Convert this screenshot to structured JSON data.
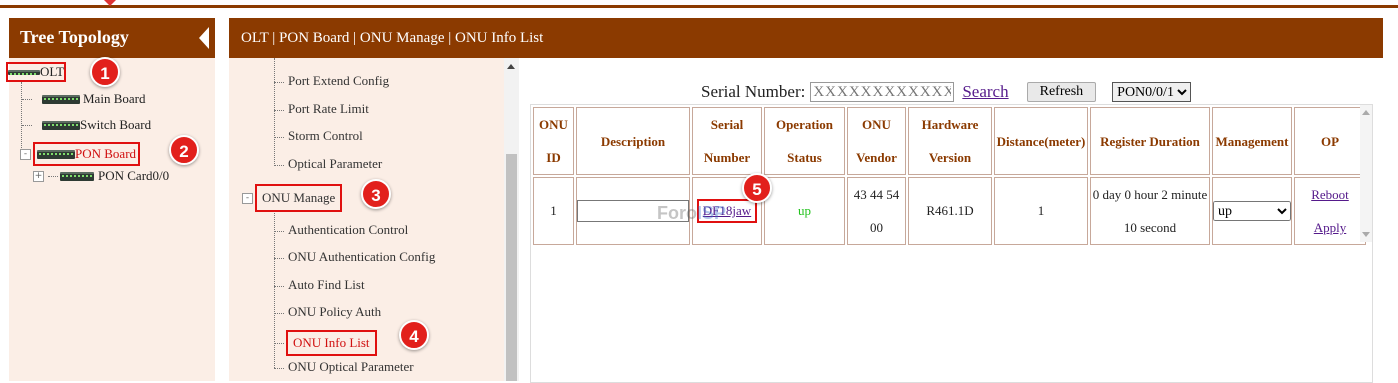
{
  "colors": {
    "brand": "#8b3a00",
    "highlight": "#e01010",
    "badge": "#e2201c",
    "status_up": "#21c21c"
  },
  "tree": {
    "title": "Tree Topology",
    "nodes": {
      "olt": "OLT",
      "main_board": "Main Board",
      "switch_board": "Switch Board",
      "pon_board": "PON Board",
      "pon_card": "PON Card0/0"
    },
    "expand_toggle": "+",
    "collapse_toggle": "-"
  },
  "breadcrumb": "OLT | PON Board | ONU Manage | ONU Info List",
  "menu": {
    "items_top": [
      "Port Extend Config",
      "Port Rate Limit",
      "Storm Control",
      "Optical Parameter"
    ],
    "group": "ONU Manage",
    "group_toggle": "-",
    "items_onu": [
      "Authentication Control",
      "ONU Authentication Config",
      "Auto Find List",
      "ONU Policy Auth",
      "ONU Info List",
      "ONU Optical Parameter"
    ]
  },
  "search": {
    "label": "Serial Number:",
    "placeholder": "XXXXXXXXXXXX",
    "search_link": "Search",
    "refresh_label": "Refresh",
    "pon_selected": "PON0/0/1"
  },
  "table": {
    "headers": {
      "onu_id": [
        "ONU",
        "ID"
      ],
      "description": "Description",
      "serial": [
        "Serial",
        "Number"
      ],
      "op_status": [
        "Operation",
        "Status"
      ],
      "vendor": [
        "ONU",
        "Vendor"
      ],
      "hw": [
        "Hardware",
        "Version"
      ],
      "distance": "Distance(meter)",
      "reg_duration": "Register Duration",
      "management": "Management",
      "op": "OP"
    },
    "rows": [
      {
        "onu_id": "1",
        "description": "",
        "serial": "DF18jaw",
        "op_status": "up",
        "vendor": [
          "43 44 54",
          "00"
        ],
        "hw": "R461.1D",
        "distance": "1",
        "reg_duration": [
          "0 day 0 hour 2 minute",
          "10 second"
        ],
        "management": "up",
        "reboot": "Reboot",
        "apply": "Apply"
      }
    ]
  },
  "watermark": "ForoISP",
  "badges": [
    "1",
    "2",
    "3",
    "4",
    "5"
  ]
}
